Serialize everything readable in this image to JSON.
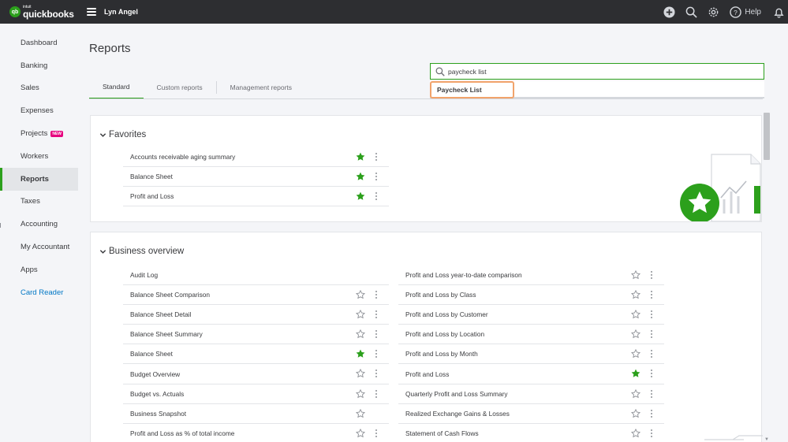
{
  "topbar": {
    "brand_small": "intuit",
    "brand": "quickbooks",
    "company": "Lyn Angel",
    "help_label": "Help",
    "icons": [
      "plus-circle-icon",
      "search-icon",
      "gear-icon",
      "help-icon",
      "bell-icon"
    ],
    "bar_color": "#2d2e31"
  },
  "sidebar": {
    "items": [
      {
        "label": "Dashboard"
      },
      {
        "label": "Banking"
      },
      {
        "label": "Sales"
      },
      {
        "label": "Expenses"
      },
      {
        "label": "Projects",
        "badge": "NEW"
      },
      {
        "label": "Workers"
      },
      {
        "label": "Reports",
        "active": true
      },
      {
        "label": "Taxes"
      },
      {
        "label": "Accounting"
      },
      {
        "label": "My Accountant"
      },
      {
        "label": "Apps"
      },
      {
        "label": "Card Reader",
        "link": true
      }
    ]
  },
  "main": {
    "title": "Reports",
    "tabs": [
      {
        "label": "Standard",
        "active": true
      },
      {
        "label": "Custom reports"
      },
      {
        "label": "Management reports"
      }
    ],
    "search": {
      "value": "paycheck list",
      "suggestion": "Paycheck List"
    }
  },
  "favorites": {
    "title": "Favorites",
    "reports": [
      {
        "name": "Accounts receivable aging summary",
        "starred": true
      },
      {
        "name": "Balance Sheet",
        "starred": true
      },
      {
        "name": "Profit and Loss",
        "starred": true
      }
    ]
  },
  "business_overview": {
    "title": "Business overview",
    "left": [
      {
        "name": "Audit Log",
        "starred": null,
        "menu": false
      },
      {
        "name": "Balance Sheet Comparison",
        "starred": false,
        "menu": true
      },
      {
        "name": "Balance Sheet Detail",
        "starred": false,
        "menu": true
      },
      {
        "name": "Balance Sheet Summary",
        "starred": false,
        "menu": true
      },
      {
        "name": "Balance Sheet",
        "starred": true,
        "menu": true
      },
      {
        "name": "Budget Overview",
        "starred": false,
        "menu": true
      },
      {
        "name": "Budget vs. Actuals",
        "starred": false,
        "menu": true
      },
      {
        "name": "Business Snapshot",
        "starred": false,
        "menu": false
      },
      {
        "name": "Profit and Loss as % of total income",
        "starred": false,
        "menu": true
      }
    ],
    "right": [
      {
        "name": "Profit and Loss year-to-date comparison",
        "starred": false,
        "menu": true
      },
      {
        "name": "Profit and Loss by Class",
        "starred": false,
        "menu": true
      },
      {
        "name": "Profit and Loss by Customer",
        "starred": false,
        "menu": true
      },
      {
        "name": "Profit and Loss by Location",
        "starred": false,
        "menu": true
      },
      {
        "name": "Profit and Loss by Month",
        "starred": false,
        "menu": true
      },
      {
        "name": "Profit and Loss",
        "starred": true,
        "menu": true
      },
      {
        "name": "Quarterly Profit and Loss Summary",
        "starred": false,
        "menu": true
      },
      {
        "name": "Realized Exchange Gains & Losses",
        "starred": false,
        "menu": true
      },
      {
        "name": "Statement of Cash Flows",
        "starred": false,
        "menu": true
      }
    ]
  },
  "colors": {
    "accent_green": "#2ca01c",
    "highlight_orange": "#f1a36b",
    "link_blue": "#0077c5",
    "new_badge": "#e6007e"
  }
}
